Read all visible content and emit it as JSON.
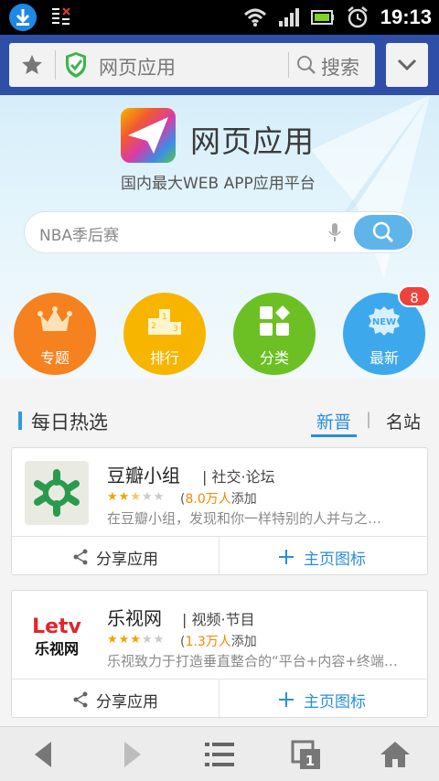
{
  "status_bar": {
    "time": "19:13"
  },
  "address_bar": {
    "title": "网页应用",
    "search_label": "搜索"
  },
  "hero": {
    "brand": "网页应用",
    "slogan": "国内最大WEB APP应用平台",
    "search_placeholder": "NBA季后赛"
  },
  "categories": [
    {
      "label": "专题",
      "color": "#f5821f",
      "icon": "crown-icon"
    },
    {
      "label": "排行",
      "color": "#f7b500",
      "icon": "podium-icon"
    },
    {
      "label": "分类",
      "color": "#6cc024",
      "icon": "category-grid-icon"
    },
    {
      "label": "最新",
      "color": "#3ea8ec",
      "icon": "new-badge-icon",
      "badge": "8",
      "badge_icon_text": "NEW"
    }
  ],
  "daily": {
    "title": "每日热选",
    "tabs": [
      {
        "label": "新晋",
        "active": true
      },
      {
        "label": "名站",
        "active": false
      }
    ]
  },
  "apps": [
    {
      "name": "豆瓣小组",
      "category": "社交·论坛",
      "rating": 2.5,
      "count": "8.0万人",
      "count_suffix": "添加",
      "count_prefix": "(",
      "description": "在豆瓣小组，发现和你一样特别的人并与之…",
      "share_label": "分享应用",
      "home_label": "主页图标"
    },
    {
      "name": "乐视网",
      "category": "视频·节目",
      "rating": 3,
      "count": "1.3万人",
      "count_suffix": "添加",
      "count_prefix": "(",
      "description": "乐视致力于打造垂直整合的“平台+内容+终端…",
      "share_label": "分享应用",
      "home_label": "主页图标",
      "logo_text_top": "Letv",
      "logo_text_bottom": "乐视网"
    }
  ],
  "bottom_nav": {
    "tabs_count": "1"
  }
}
